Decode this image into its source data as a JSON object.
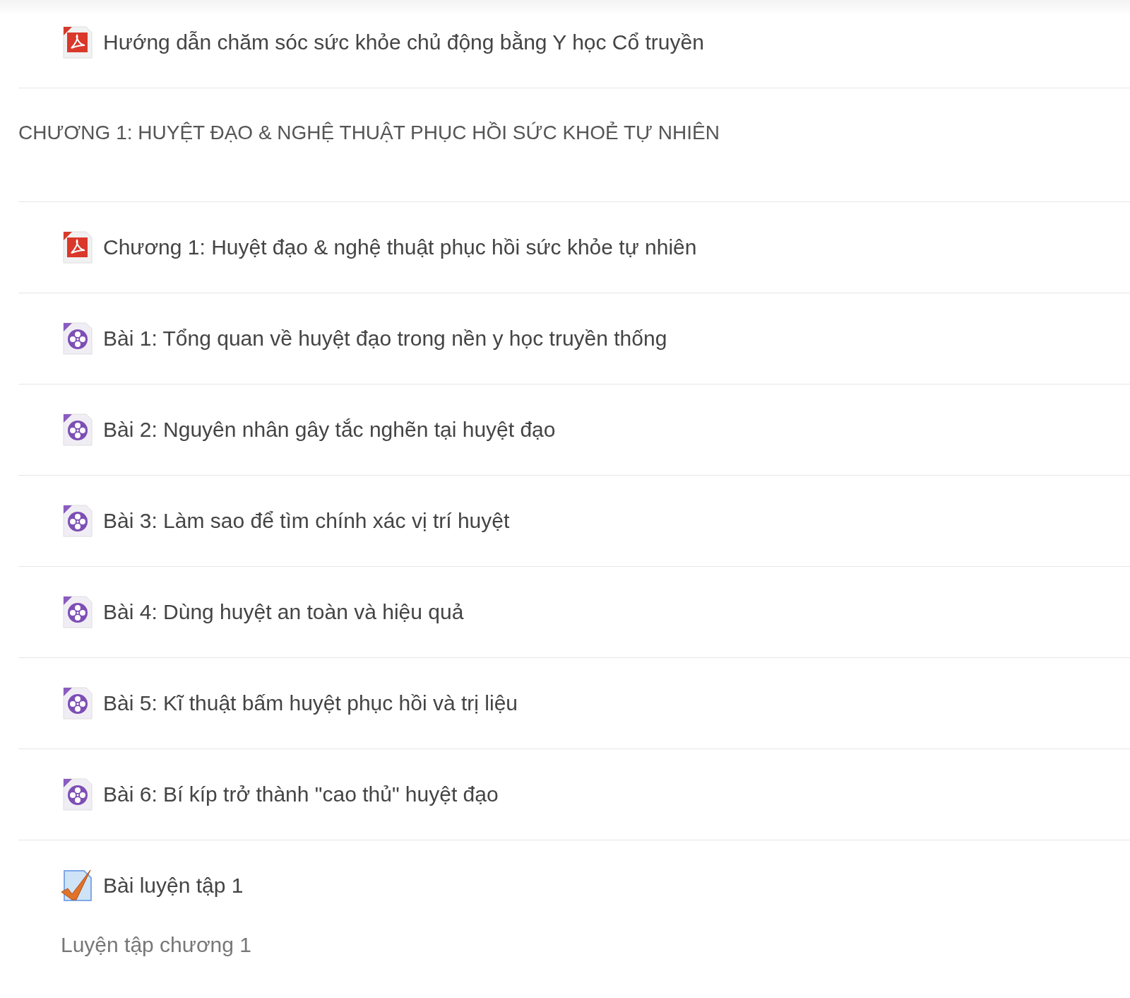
{
  "sections": [
    {
      "activities": [
        {
          "kind": "pdf",
          "title": "Hướng dẫn chăm sóc sức khỏe chủ động bằng Y học Cổ truyền"
        }
      ]
    },
    {
      "title": "CHƯƠNG 1: HUYỆT ĐẠO & NGHỆ THUẬT PHỤC HỒI SỨC KHOẺ TỰ NHIÊN",
      "activities": [
        {
          "kind": "pdf",
          "title": "Chương 1: Huyệt đạo & nghệ thuật phục hồi sức khỏe tự nhiên"
        },
        {
          "kind": "video",
          "title": "Bài 1: Tổng quan về huyệt đạo trong nền y học truyền thống"
        },
        {
          "kind": "video",
          "title": "Bài 2: Nguyên nhân gây tắc nghẽn tại huyệt đạo"
        },
        {
          "kind": "video",
          "title": "Bài 3: Làm sao để tìm chính xác vị trí huyệt"
        },
        {
          "kind": "video",
          "title": "Bài 4: Dùng huyệt an toàn và hiệu quả"
        },
        {
          "kind": "video",
          "title": "Bài 5: Kĩ thuật bấm huyệt phục hồi và trị liệu"
        },
        {
          "kind": "video",
          "title": "Bài 6: Bí kíp trở thành \"cao thủ\" huyệt đạo"
        },
        {
          "kind": "quiz",
          "title": "Bài luyện tập 1",
          "description": "Luyện tập chương 1"
        }
      ]
    }
  ]
}
